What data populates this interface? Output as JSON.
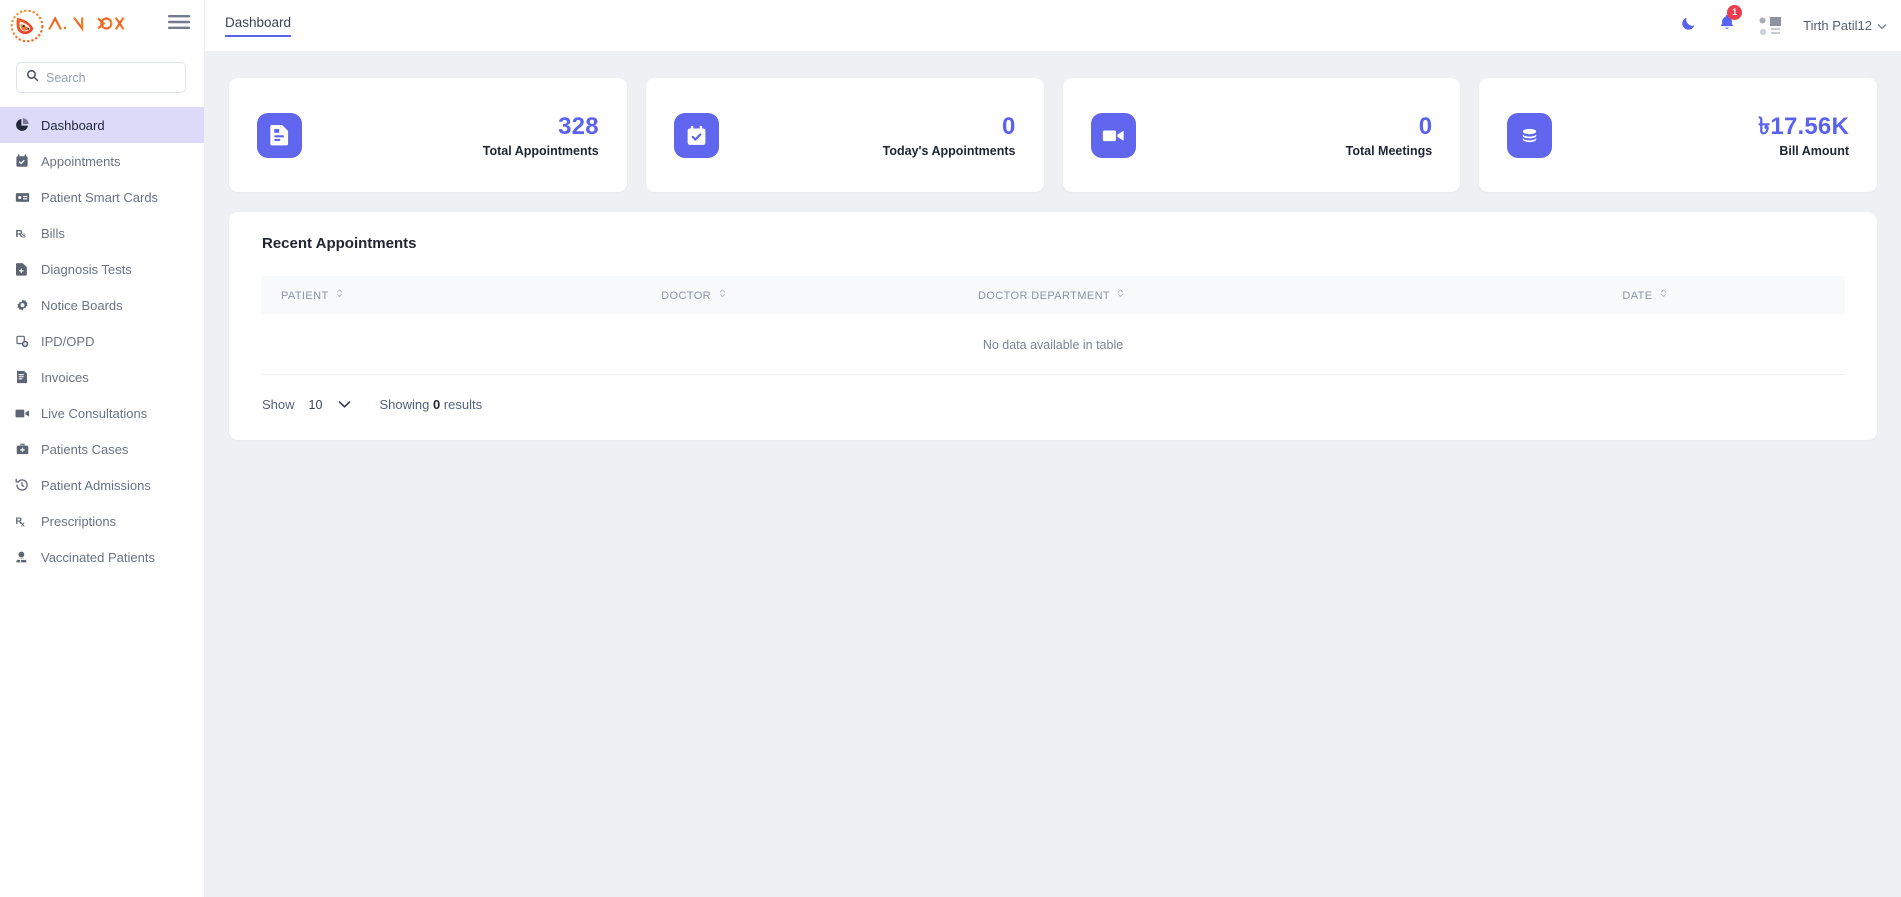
{
  "brand": {
    "name": "AIINFOX",
    "logo_icon": "fox-logo-icon",
    "menu_icon": "hamburger-menu-icon"
  },
  "search": {
    "placeholder": "Search",
    "value": "",
    "icon": "search-icon"
  },
  "sidebar": {
    "items": [
      {
        "label": "Dashboard",
        "icon": "pie-chart-icon",
        "active": true
      },
      {
        "label": "Appointments",
        "icon": "calendar-check-icon",
        "active": false
      },
      {
        "label": "Patient Smart Cards",
        "icon": "id-card-icon",
        "active": false
      },
      {
        "label": "Bills",
        "icon": "rupee-icon",
        "active": false
      },
      {
        "label": "Diagnosis Tests",
        "icon": "file-medical-icon",
        "active": false
      },
      {
        "label": "Notice Boards",
        "icon": "gear-icon",
        "active": false
      },
      {
        "label": "IPD/OPD",
        "icon": "hospital-bed-icon",
        "active": false
      },
      {
        "label": "Invoices",
        "icon": "invoice-icon",
        "active": false
      },
      {
        "label": "Live Consultations",
        "icon": "video-camera-icon",
        "active": false
      },
      {
        "label": "Patients Cases",
        "icon": "medical-bag-icon",
        "active": false
      },
      {
        "label": "Patient Admissions",
        "icon": "history-clock-icon",
        "active": false
      },
      {
        "label": "Prescriptions",
        "icon": "prescription-rx-icon",
        "active": false
      },
      {
        "label": "Vaccinated Patients",
        "icon": "syringe-icon",
        "active": false
      }
    ]
  },
  "topbar": {
    "breadcrumb": "Dashboard",
    "dark_mode_icon": "moon-icon",
    "notification_icon": "bell-icon",
    "notification_count": "1",
    "thumbnail_icon": "image-thumbnail-icon",
    "user_name": "Tirth Patil12",
    "user_chevron_icon": "chevron-down-icon"
  },
  "stats": {
    "cards": [
      {
        "value": "328",
        "label": "Total Appointments",
        "icon": "document-report-icon",
        "currency": ""
      },
      {
        "value": "0",
        "label": "Today's Appointments",
        "icon": "calendar-check-icon",
        "currency": ""
      },
      {
        "value": "0",
        "label": "Total Meetings",
        "icon": "video-camera-icon",
        "currency": ""
      },
      {
        "value": "17.56K",
        "label": "Bill Amount",
        "icon": "coin-stack-icon",
        "currency": "৳"
      }
    ]
  },
  "recent_appointments": {
    "title": "Recent Appointments",
    "columns": [
      "PATIENT",
      "DOCTOR",
      "DOCTOR DEPARTMENT",
      "DATE"
    ],
    "rows": [],
    "empty_message": "No data available in table",
    "footer": {
      "show_label": "Show",
      "page_size": "10",
      "showing_prefix": "Showing",
      "showing_count": "0",
      "showing_suffix": "results"
    }
  },
  "colors": {
    "accent": "#5b63ee",
    "icon_tile": "#6067ee",
    "active_nav_bg": "#dddaf9",
    "badge_red": "#ef3b4e",
    "page_bg": "#eef0f4"
  }
}
